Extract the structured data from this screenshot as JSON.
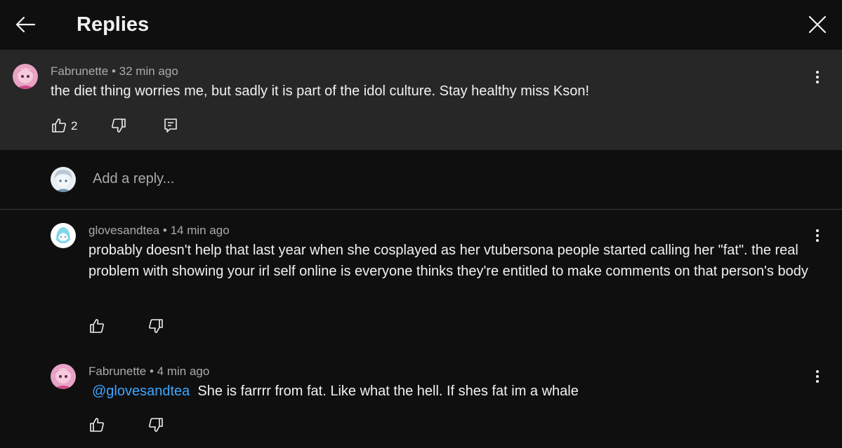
{
  "header": {
    "title": "Replies",
    "back_icon": "arrow-left-icon",
    "close_icon": "close-icon"
  },
  "parent_comment": {
    "author": "Fabrunette",
    "time": "32 min ago",
    "text": "the diet thing worries me, but sadly it is part of the idol culture. Stay healthy miss Kson!",
    "likes": "2"
  },
  "reply_box": {
    "placeholder": "Add a reply..."
  },
  "replies": [
    {
      "author": "glovesandtea",
      "time": "14 min ago",
      "text": "probably doesn't help that last year when she cosplayed as her vtubersona people started calling her \"fat\". the real problem with showing your irl self online is everyone thinks they're entitled to make comments on that person's body"
    },
    {
      "author": "Fabrunette",
      "time": "4 min ago",
      "mention": "@glovesandtea",
      "text": "She is farrrr from fat. Like what the hell. If shes fat im a whale"
    }
  ],
  "colors": {
    "background": "#0f0f0f",
    "highlight": "#272727",
    "mention": "#3ea6ff",
    "meta": "#aaaaaa"
  }
}
